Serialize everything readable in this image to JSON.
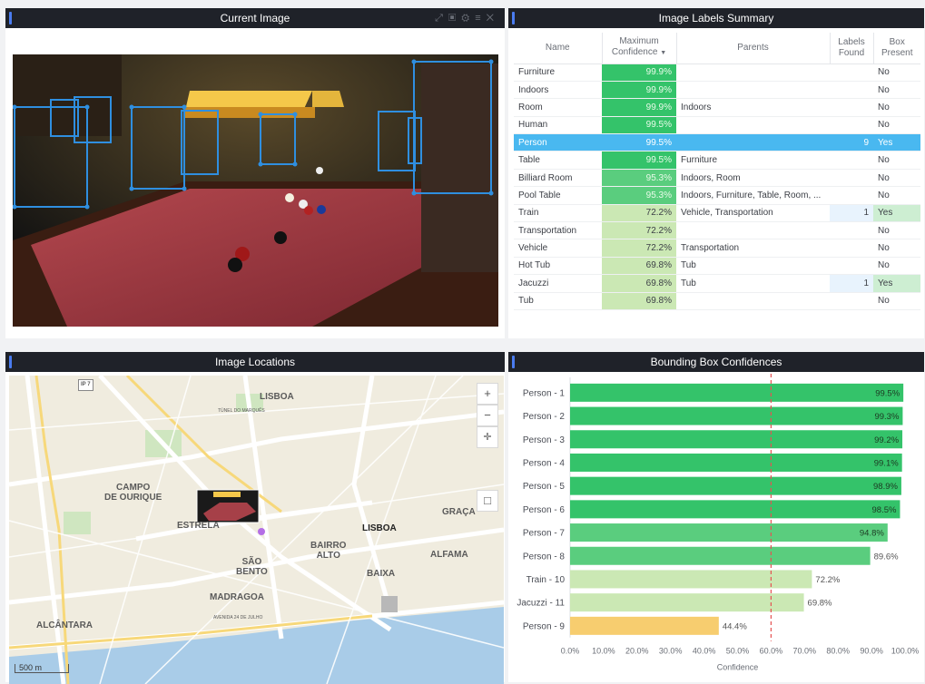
{
  "panels": {
    "image_title": "Current Image",
    "labels_title": "Image Labels Summary",
    "locations_title": "Image Locations",
    "boxes_title": "Bounding Box Confidences"
  },
  "table": {
    "headers": {
      "name": "Name",
      "max1": "Maximum",
      "max2": "Confidence",
      "parents": "Parents",
      "found1": "Labels",
      "found2": "Found",
      "box1": "Box",
      "box2": "Present"
    },
    "rows": [
      {
        "name": "Furniture",
        "conf": "99.9%",
        "conf_value": 99.9,
        "parents": "",
        "found": "",
        "box": "No"
      },
      {
        "name": "Indoors",
        "conf": "99.9%",
        "conf_value": 99.9,
        "parents": "",
        "found": "",
        "box": "No"
      },
      {
        "name": "Room",
        "conf": "99.9%",
        "conf_value": 99.9,
        "parents": "Indoors",
        "found": "",
        "box": "No"
      },
      {
        "name": "Human",
        "conf": "99.5%",
        "conf_value": 99.5,
        "parents": "",
        "found": "",
        "box": "No"
      },
      {
        "name": "Person",
        "conf": "99.5%",
        "conf_value": 99.5,
        "parents": "",
        "found": "9",
        "box": "Yes"
      },
      {
        "name": "Table",
        "conf": "99.5%",
        "conf_value": 99.5,
        "parents": "Furniture",
        "found": "",
        "box": "No"
      },
      {
        "name": "Billiard Room",
        "conf": "95.3%",
        "conf_value": 95.3,
        "parents": "Indoors, Room",
        "found": "",
        "box": "No"
      },
      {
        "name": "Pool Table",
        "conf": "95.3%",
        "conf_value": 95.3,
        "parents": "Indoors, Furniture, Table, Room, ...",
        "found": "",
        "box": "No"
      },
      {
        "name": "Train",
        "conf": "72.2%",
        "conf_value": 72.2,
        "parents": "Vehicle, Transportation",
        "found": "1",
        "box": "Yes"
      },
      {
        "name": "Transportation",
        "conf": "72.2%",
        "conf_value": 72.2,
        "parents": "",
        "found": "",
        "box": "No"
      },
      {
        "name": "Vehicle",
        "conf": "72.2%",
        "conf_value": 72.2,
        "parents": "Transportation",
        "found": "",
        "box": "No"
      },
      {
        "name": "Hot Tub",
        "conf": "69.8%",
        "conf_value": 69.8,
        "parents": "Tub",
        "found": "",
        "box": "No"
      },
      {
        "name": "Jacuzzi",
        "conf": "69.8%",
        "conf_value": 69.8,
        "parents": "Tub",
        "found": "1",
        "box": "Yes"
      },
      {
        "name": "Tub",
        "conf": "69.8%",
        "conf_value": 69.8,
        "parents": "",
        "found": "",
        "box": "No"
      }
    ],
    "selected_row": "Person"
  },
  "map": {
    "labels": {
      "lisboa_n": "LISBOA",
      "campo": "CAMPO\nDE OURIQUE",
      "estrela": "ESTRELA",
      "graca": "GRAÇA",
      "lisboa_c": "LISBOA",
      "bairro": "BAIRRO\nALTO",
      "alfama": "ALFAMA",
      "sao_bento": "SÃO\nBENTO",
      "baixa": "BAIXA",
      "madragoa": "MADRAGOA",
      "alcantara": "ALCÂNTARA",
      "tunel": "TÚNEL DO MARQUÊS",
      "av24": "AVENIDA 24 DE JULHO",
      "ip7": "IP 7"
    },
    "scale": "500 m",
    "zoom_in": "+",
    "zoom_out": "−"
  },
  "colors": {
    "header_bg": "#1f2229",
    "accent": "#4a7cf0",
    "high": "#34c36a",
    "medium": "#5acd7e",
    "low": "#cbe8b4",
    "warn": "#f7cd6f",
    "selected": "#49b8f0",
    "threshold": "#e55353"
  },
  "chart_data": {
    "type": "bar",
    "orientation": "horizontal",
    "categories": [
      "Person - 1",
      "Person - 2",
      "Person - 3",
      "Person - 4",
      "Person - 5",
      "Person - 6",
      "Person - 7",
      "Person - 8",
      "Train - 10",
      "Jacuzzi - 11",
      "Person - 9"
    ],
    "values": [
      99.5,
      99.3,
      99.2,
      99.1,
      98.9,
      98.5,
      94.8,
      89.6,
      72.2,
      69.8,
      44.4
    ],
    "value_labels": [
      "99.5%",
      "99.3%",
      "99.2%",
      "99.1%",
      "98.9%",
      "98.5%",
      "94.8%",
      "89.6%",
      "72.2%",
      "69.8%",
      "44.4%"
    ],
    "xlabel": "Confidence",
    "xlim": [
      0,
      100
    ],
    "xticks": [
      "0.0%",
      "10.0%",
      "20.0%",
      "30.0%",
      "40.0%",
      "50.0%",
      "60.0%",
      "70.0%",
      "80.0%",
      "90.0%",
      "100.0%"
    ],
    "threshold": 60
  }
}
